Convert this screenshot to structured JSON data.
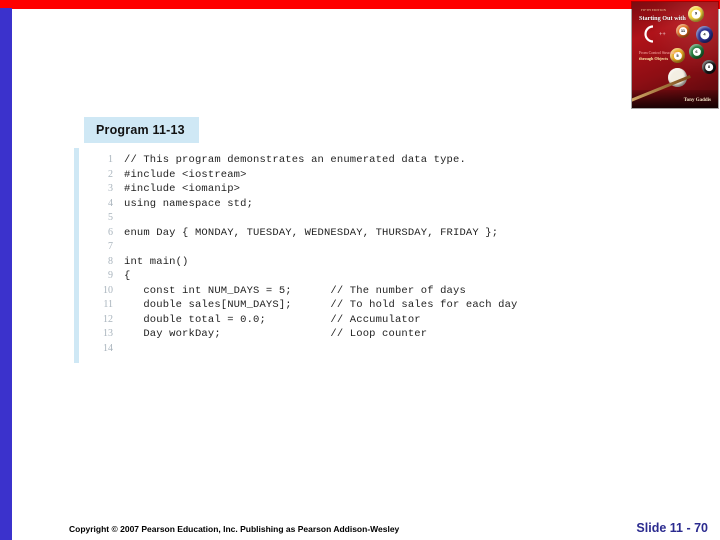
{
  "theme": {
    "top_bar_color": "#fe0000",
    "left_bar_color": "#3b32cc",
    "header_box_color": "#cfe8f5",
    "slide_number_color": "#2b2b8f",
    "line_number_color": "#a9b4bd"
  },
  "figure": {
    "header_label": "Program 11-13",
    "lines": [
      {
        "number": "1",
        "code": "// This program demonstrates an enumerated data type."
      },
      {
        "number": "2",
        "code": "#include <iostream>"
      },
      {
        "number": "3",
        "code": "#include <iomanip>"
      },
      {
        "number": "4",
        "code": "using namespace std;"
      },
      {
        "number": "5",
        "code": ""
      },
      {
        "number": "6",
        "code": "enum Day { MONDAY, TUESDAY, WEDNESDAY, THURSDAY, FRIDAY };"
      },
      {
        "number": "7",
        "code": ""
      },
      {
        "number": "8",
        "code": "int main()"
      },
      {
        "number": "9",
        "code": "{"
      },
      {
        "number": "10",
        "code": "   const int NUM_DAYS = 5;      // The number of days"
      },
      {
        "number": "11",
        "code": "   double sales[NUM_DAYS];      // To hold sales for each day"
      },
      {
        "number": "12",
        "code": "   double total = 0.0;          // Accumulator"
      },
      {
        "number": "13",
        "code": "   Day workDay;                 // Loop counter"
      },
      {
        "number": "14",
        "code": ""
      }
    ]
  },
  "book_cover": {
    "edition": "FIFTH EDITION",
    "title": "Starting Out with",
    "language": "C++",
    "subtitle_line1": "From Control Structures",
    "subtitle_line2": "through Objects",
    "author": "Tony Gaddis",
    "balls": [
      {
        "label": "9",
        "color": "#f2d23c"
      },
      {
        "label": "11",
        "color": "#e06a1b"
      },
      {
        "label": "4",
        "color": "#2b2f8f"
      },
      {
        "label": "6",
        "color": "#1f7a3a"
      },
      {
        "label": "5",
        "color": "#e8a820"
      },
      {
        "label": "8",
        "color": "#151515"
      }
    ]
  },
  "footer": {
    "copyright": "Copyright © 2007 Pearson Education, Inc. Publishing as Pearson Addison-Wesley",
    "slide_number": "Slide 11 - 70"
  }
}
